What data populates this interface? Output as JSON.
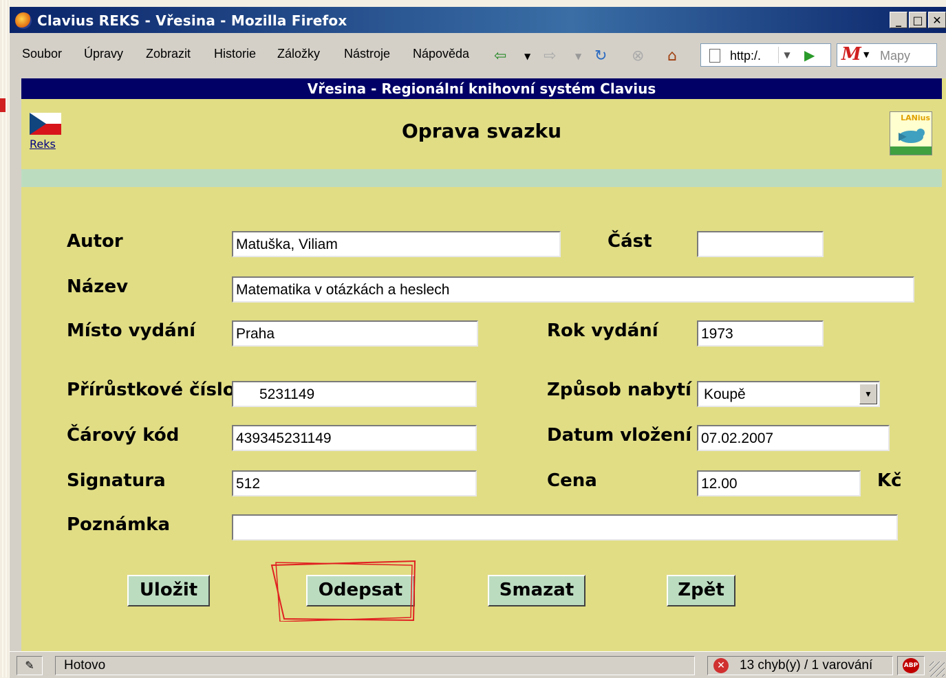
{
  "window": {
    "title": "Clavius REKS - Vřesina - Mozilla Firefox"
  },
  "menu": {
    "items": [
      "Soubor",
      "Úpravy",
      "Zobrazit",
      "Historie",
      "Záložky",
      "Nástroje",
      "Nápověda"
    ]
  },
  "toolbar": {
    "url": "http:/.",
    "search_placeholder": "Mapy",
    "gmail_letter": "M"
  },
  "header": {
    "system": "Vřesina - Regionální knihovní systém Clavius",
    "title": "Oprava svazku",
    "reks_link": "Reks",
    "lanius_logo": "LANius"
  },
  "form": {
    "autor_label": "Autor",
    "autor": "Matuška, Viliam",
    "cast_label": "Část",
    "cast": "",
    "nazev_label": "Název",
    "nazev": "Matematika v otázkách a heslech",
    "misto_label": "Místo vydání",
    "misto": "Praha",
    "rok_label": "Rok vydání",
    "rok": "1973",
    "prirustkove_label": "Přírůstkové číslo",
    "prirustkove": "5231149",
    "zpusob_label": "Způsob nabytí",
    "zpusob": "Koupě",
    "carovy_label": "Čárový kód",
    "carovy": "439345231149",
    "datum_label": "Datum vložení",
    "datum": "07.02.2007",
    "signatura_label": "Signatura",
    "signatura": "512",
    "cena_label": "Cena",
    "cena": "12.00",
    "mena": "Kč",
    "poznamka_label": "Poznámka",
    "poznamka": ""
  },
  "buttons": {
    "ulozit": "Uložit",
    "odepsat": "Odepsat",
    "smazat": "Smazat",
    "zpet": "Zpět"
  },
  "status": {
    "text": "Hotovo",
    "errors": "13 chyb(y) / 1 varování",
    "abp": "ABP"
  },
  "colors": {
    "content_bg": "#e0dd85",
    "sysbar_bg": "#000066",
    "button_bg": "#bcdcc0",
    "annotation": "#e02020"
  }
}
